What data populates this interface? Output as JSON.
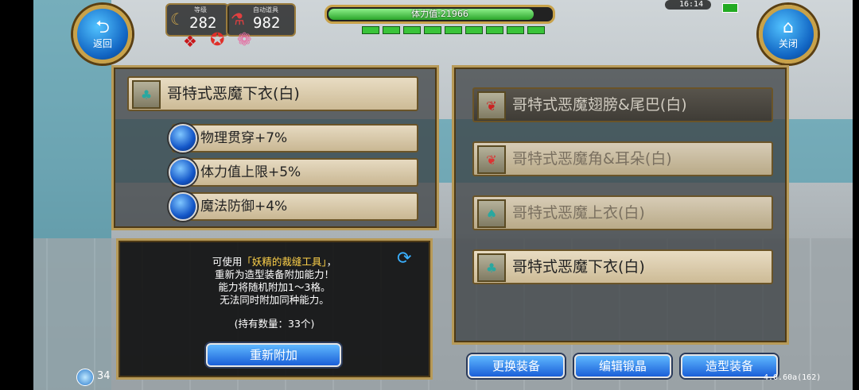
{
  "top": {
    "back_label": "返回",
    "close_label": "关闭",
    "level_caption": "等级",
    "level_value": "282",
    "auto_item_caption": "自动道具",
    "auto_item_value": "982",
    "stamina_text": "体力值:21966",
    "stamina_fraction": 0.92,
    "clock": "16:14"
  },
  "left_panel": {
    "selected_item": "哥特式恶魔下衣(白)",
    "abilities": [
      {
        "label": "物理贯穿+7%"
      },
      {
        "label": "体力值上限+5%"
      },
      {
        "label": "魔法防御+4%"
      }
    ]
  },
  "info": {
    "line1_prefix": "可使用",
    "line1_highlight": "「妖精的裁缝工具」",
    "line1_suffix": "，",
    "line2": "重新为造型装备附加能力！",
    "line3": "能力将随机附加1～3格。",
    "line4": "无法同时附加同种能力。",
    "holding": "(持有数量：33个)",
    "reattach_label": "重新附加"
  },
  "right_panel": {
    "items": [
      {
        "label": "哥特式恶魔翅膀&尾巴(白)"
      },
      {
        "label": "哥特式恶魔角&耳朵(白)"
      },
      {
        "label": "哥特式恶魔上衣(白)"
      },
      {
        "label": "哥特式恶魔下衣(白)"
      }
    ]
  },
  "bottom": {
    "change_equipment": "更换装备",
    "edit_forge": "编辑锻晶",
    "costume_equipment": "造型装备",
    "counter": "34",
    "version": "4.0.60a(162)"
  },
  "colors": {
    "accent_gold": "#b79a58",
    "button_blue": "#1a5fd8",
    "highlight_yellow": "#ffd24a"
  }
}
